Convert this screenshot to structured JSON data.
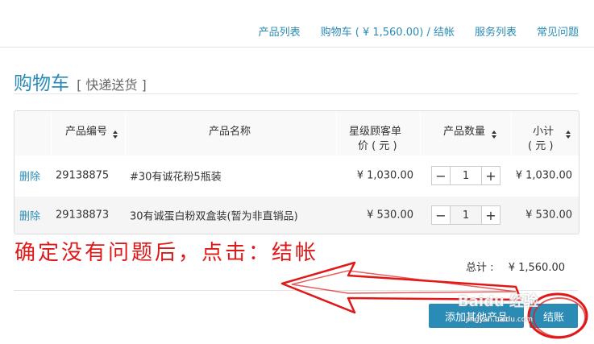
{
  "nav": {
    "items": [
      "产品列表",
      "购物车 ( ¥ 1,560.00) / 结帐",
      "服务列表",
      "常见问题"
    ]
  },
  "page": {
    "title": "购物车",
    "subtitle": "[ 快递送货 ]"
  },
  "table": {
    "headers": {
      "sku": "产品编号",
      "name": "产品名称",
      "price_line1": "星级顾客单",
      "price_line2": "价 ( 元 )",
      "qty": "产品数量",
      "subtotal_line1": "小计",
      "subtotal_line2": "( 元 )"
    },
    "rows": [
      {
        "delete": "删除",
        "sku": "29138875",
        "name": "#30有诚花粉5瓶装",
        "price": "¥ 1,030.00",
        "qty": "1",
        "subtotal": "¥ 1,030.00"
      },
      {
        "delete": "删除",
        "sku": "29138873",
        "name": "30有诚蛋白粉双盒装(暂为非直销品)",
        "price": "¥ 530.00",
        "qty": "1",
        "subtotal": "¥ 530.00"
      }
    ]
  },
  "annotation": "确定没有问题后，点击：结帐",
  "total": {
    "label": "总计 :",
    "amount": "¥ 1,560.00"
  },
  "actions": {
    "add_other": "添加其他产品",
    "checkout": "结账"
  },
  "watermark": {
    "brand": "Baidu 经验",
    "url": "jingyan.baidu.com"
  },
  "colors": {
    "accent": "#2a8bb5",
    "annotation": "#e01818"
  }
}
